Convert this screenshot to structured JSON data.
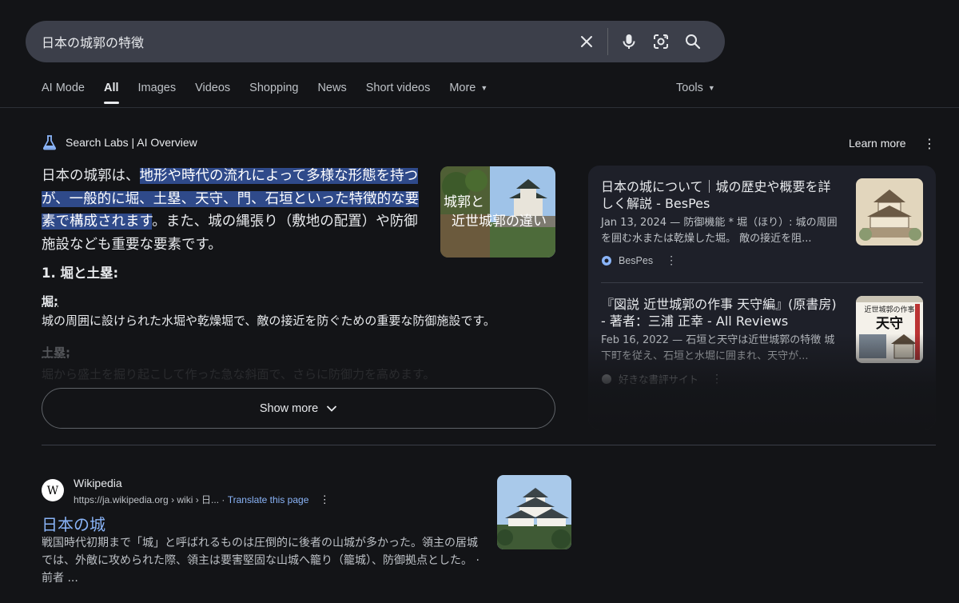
{
  "search": {
    "query": "日本の城郭の特徴"
  },
  "tabs": [
    {
      "label": "AI Mode"
    },
    {
      "label": "All"
    },
    {
      "label": "Images"
    },
    {
      "label": "Videos"
    },
    {
      "label": "Shopping"
    },
    {
      "label": "News"
    },
    {
      "label": "Short videos"
    },
    {
      "label": "More"
    }
  ],
  "tools_label": "Tools",
  "ai_overview": {
    "header": "Search Labs | AI Overview",
    "learn_more": "Learn more",
    "intro_plain": "日本の城郭は、",
    "intro_highlight": "地形や時代の流れによって多様な形態を持つが、一般的に堀、土塁、天守、門、石垣といった特徴的な要素で構成されます",
    "intro_rest": "。また、城の縄張り（敷地の配置）や防御施設なども重要な要素です。",
    "thumb_text": "城郭と近世城郭の違い",
    "section_title": "1. 堀と土塁:",
    "item1_title": "堀:",
    "item1_text": "城の周囲に設けられた水堀や乾燥堀で、敵の接近を防ぐための重要な防御施設です。",
    "item2_title": "土塁:",
    "item2_text": "堀から盛土を掘り起こして作った急な斜面で、さらに防御力を高めます。",
    "show_more": "Show more",
    "sources": [
      {
        "title": "日本の城について｜城の歴史や概要を詳しく解説 - BesPes",
        "snippet": "Jan 13, 2024 — 防御機能 * 堀（ほり）: 城の周囲を囲む水または乾燥した堀。 敵の接近を阻...",
        "site": "BesPes"
      },
      {
        "title": "『図説 近世城郭の作事 天守編』(原書房) - 著者：三浦 正幸 - All Reviews",
        "snippet": "Feb 16, 2022 — 石垣と天守は近世城郭の特徴 城下町を従え、石垣と水堀に囲まれ、天守が...",
        "site": "好きな書評サイト",
        "thumb_text_top": "近世城郭の作事",
        "thumb_text_main": "天守"
      }
    ]
  },
  "result": {
    "site_name": "Wikipedia",
    "url": "https://ja.wikipedia.org › wiki › 日...",
    "translate": "Translate this page",
    "title": "日本の城",
    "snippet": "戦国時代初期まで「城」と呼ばれるものは圧倒的に後者の山城が多かった。領主の居城では、外敵に攻められた際、領主は要害堅固な山城へ籠り（籠城）、防御拠点とした。 · 前者 ..."
  }
}
